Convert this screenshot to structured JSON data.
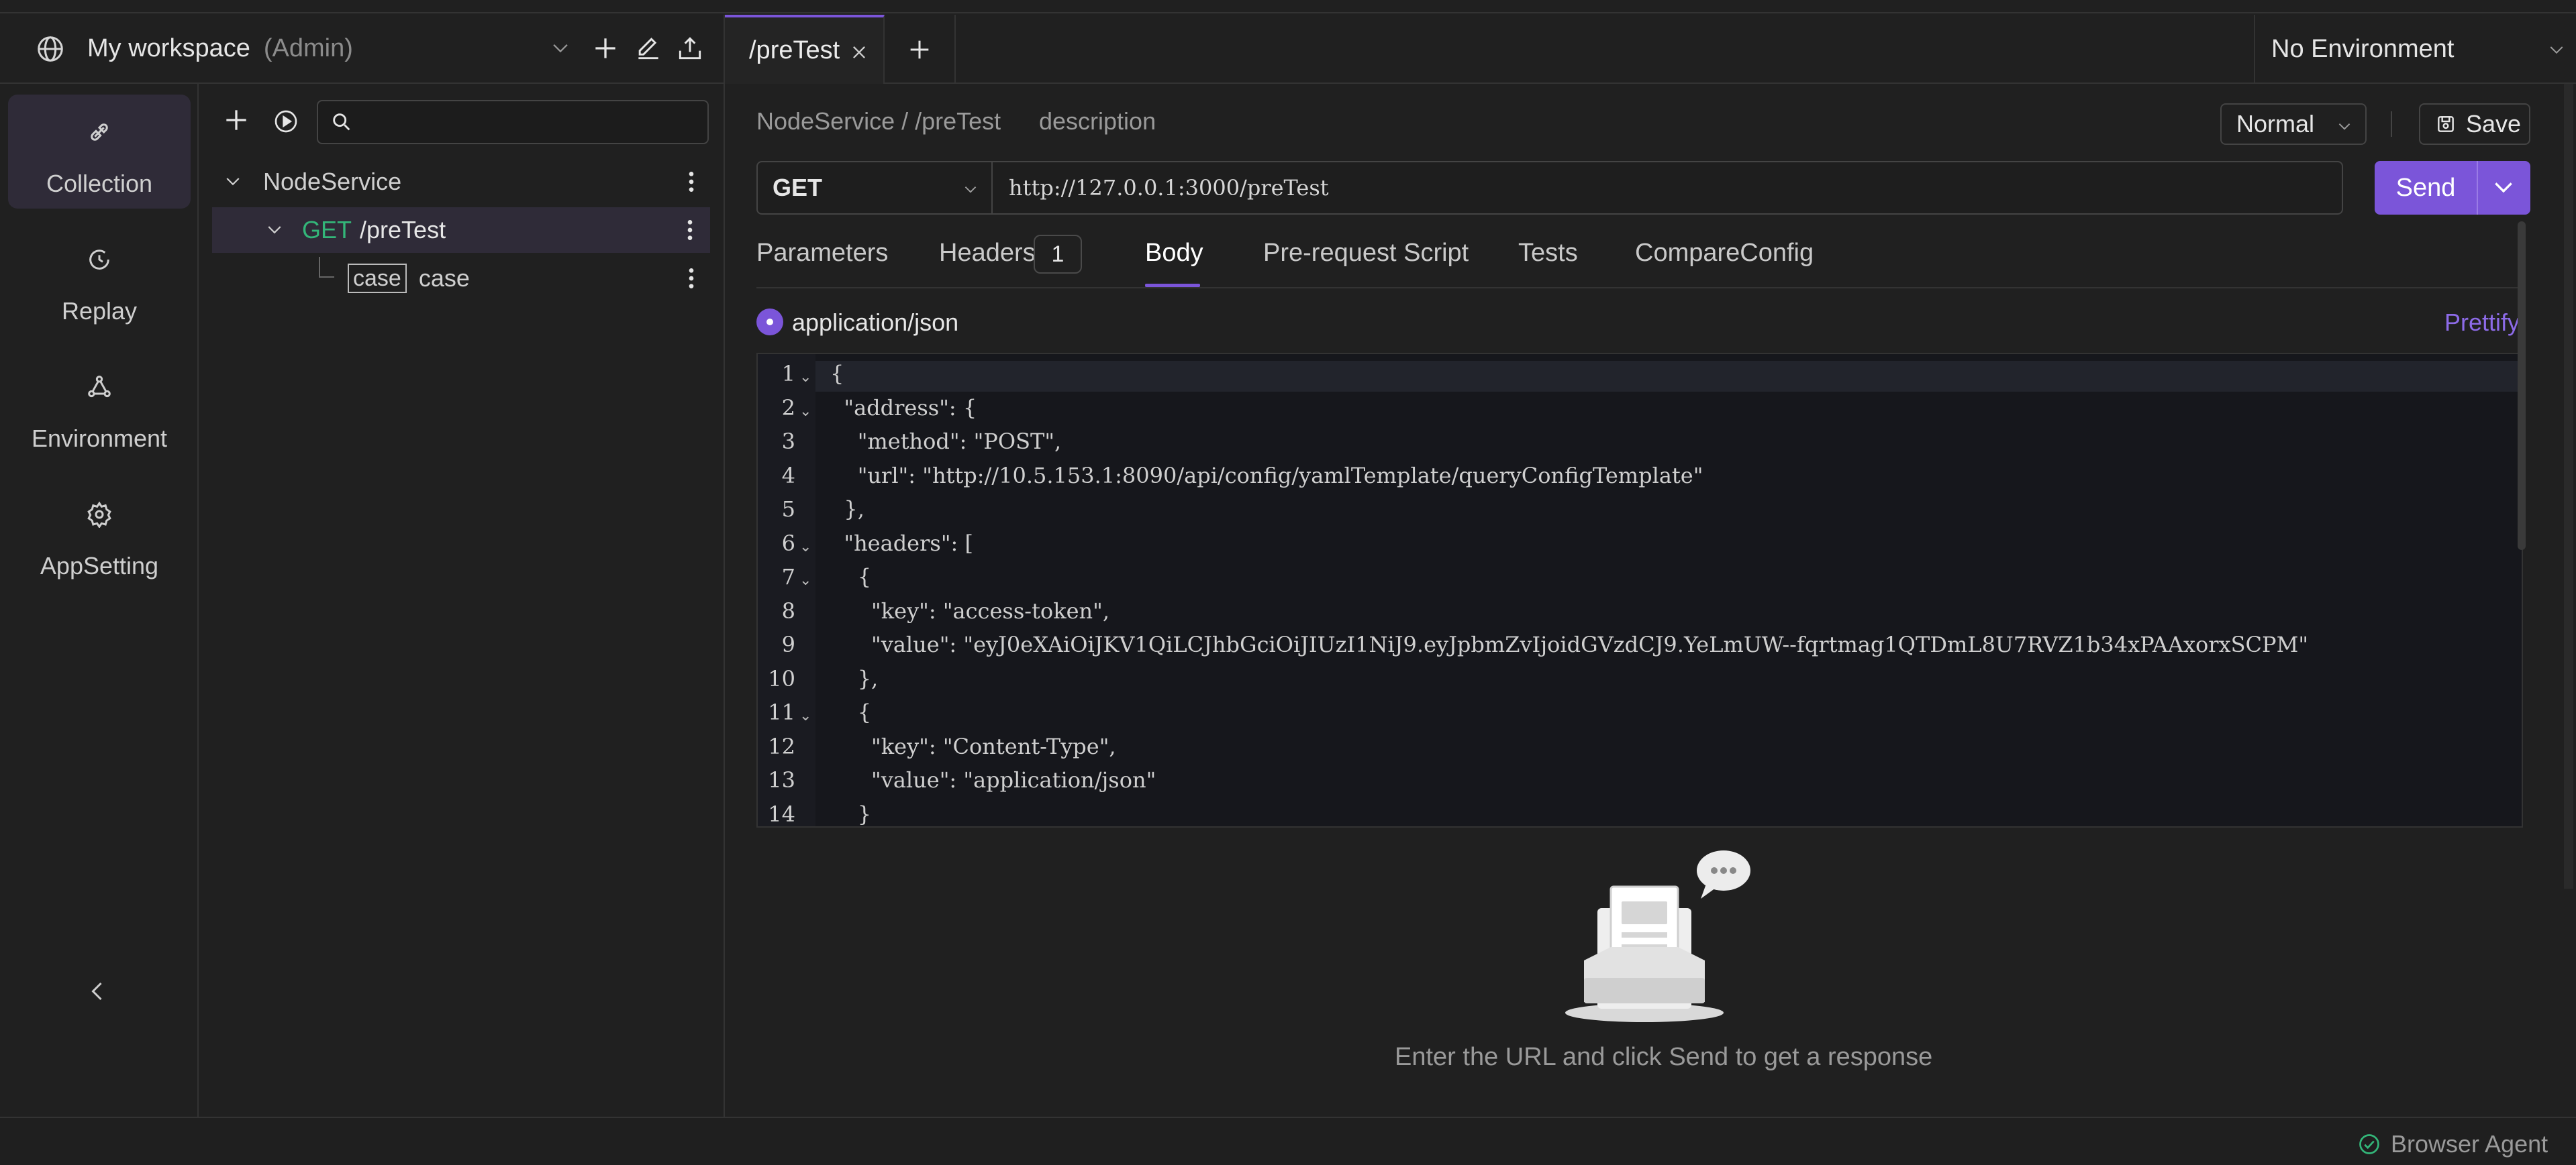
{
  "workspace": {
    "name": "My workspace",
    "role": "(Admin)"
  },
  "rail": {
    "items": [
      {
        "label": "Collection",
        "icon": "collection-icon",
        "active": true
      },
      {
        "label": "Replay",
        "icon": "replay-icon"
      },
      {
        "label": "Environment",
        "icon": "environment-icon"
      },
      {
        "label": "AppSetting",
        "icon": "gear-icon"
      }
    ]
  },
  "tree": {
    "search_placeholder": "",
    "items": [
      {
        "label": "NodeService"
      },
      {
        "method": "GET",
        "label": "/preTest"
      },
      {
        "tag": "case",
        "label": "case"
      }
    ]
  },
  "tabs": {
    "active_label": "/preTest"
  },
  "environment": {
    "label": "No Environment"
  },
  "request": {
    "breadcrumb": "NodeService / /preTest",
    "description": "description",
    "mode": "Normal",
    "save_label": "Save",
    "method": "GET",
    "url": "http://127.0.0.1:3000/preTest",
    "send_label": "Send",
    "tabs": {
      "parameters": "Parameters",
      "headers": "Headers",
      "headers_count": "1",
      "body": "Body",
      "prerequest": "Pre-request Script",
      "tests": "Tests",
      "compare": "CompareConfig"
    },
    "content_type": "application/json",
    "prettify": "Prettify",
    "code_lines": [
      "{",
      "  \"address\": {",
      "    \"method\": \"POST\",",
      "    \"url\": \"http://10.5.153.1:8090/api/config/yamlTemplate/queryConfigTemplate\"",
      "  },",
      "  \"headers\": [",
      "    {",
      "      \"key\": \"access-token\",",
      "      \"value\": \"eyJ0eXAiOiJKV1QiLCJhbGciOiJIUzI1NiJ9.eyJpbmZvIjoidGVzdCJ9.YeLmUW--fqrtmag1QTDmL8U7RVZ1b34xPAAxorxSCPM\"",
      "    },",
      "    {",
      "      \"key\": \"Content-Type\",",
      "      \"value\": \"application/json\"",
      "    }"
    ],
    "line_numbers": [
      "1",
      "2",
      "3",
      "4",
      "5",
      "6",
      "7",
      "8",
      "9",
      "10",
      "11",
      "12",
      "13",
      "14"
    ]
  },
  "response": {
    "empty_text": "Enter the URL and click Send to get a response"
  },
  "status": {
    "agent": "Browser Agent"
  },
  "colors": {
    "accent": "#7b55d9",
    "get": "#33b679",
    "background": "#202020"
  }
}
